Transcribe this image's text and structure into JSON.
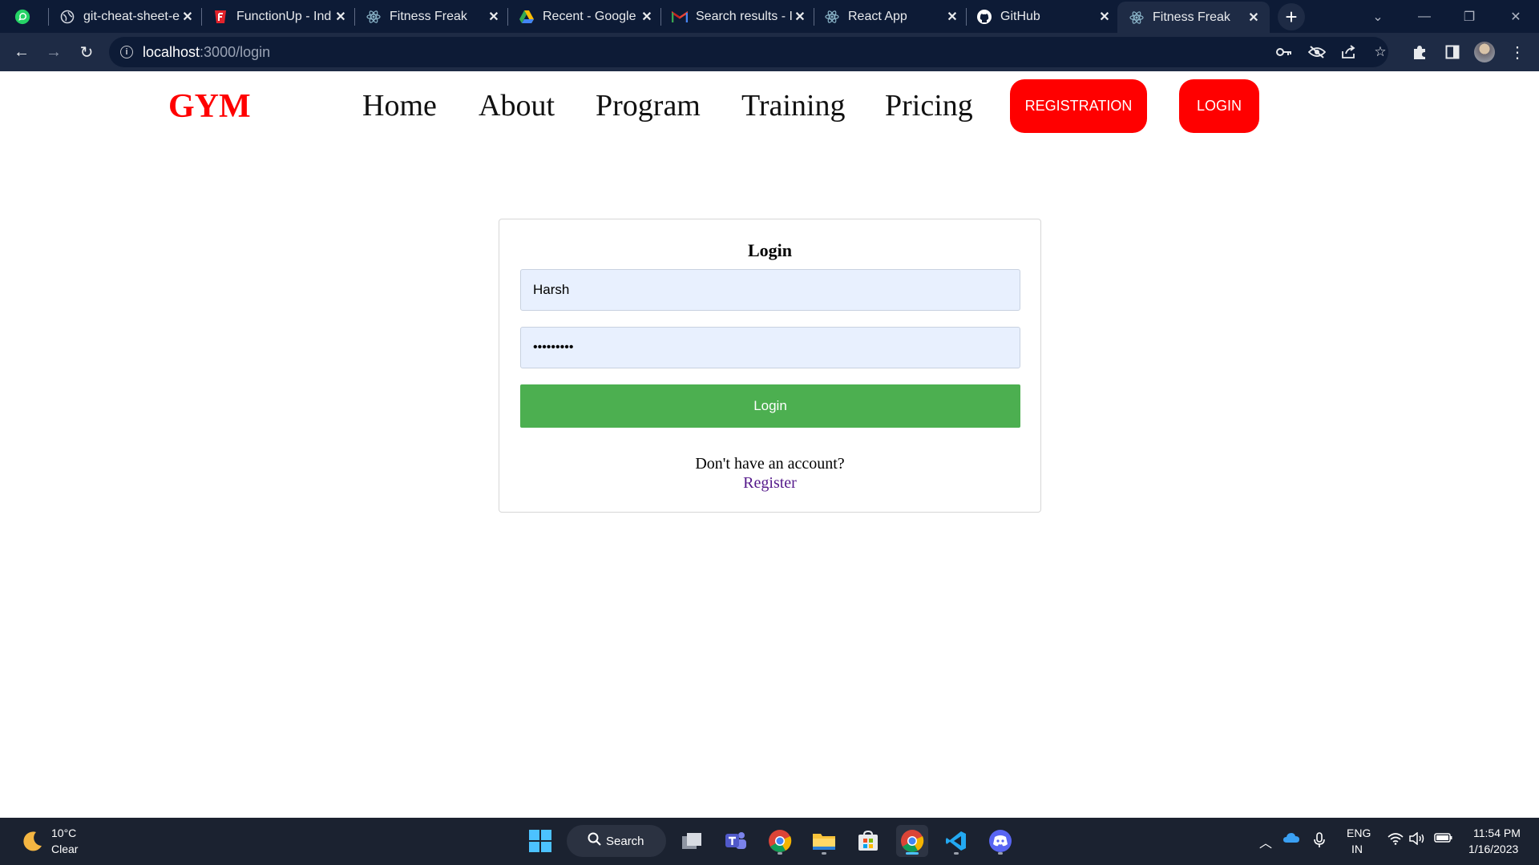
{
  "browser": {
    "tabs": [
      {
        "title": "",
        "icon": "whatsapp-icon"
      },
      {
        "title": "git-cheat-sheet-e",
        "icon": "globe-icon"
      },
      {
        "title": "FunctionUp - Ind",
        "icon": "functionup-icon"
      },
      {
        "title": "Fitness Freak",
        "icon": "react-icon"
      },
      {
        "title": "Recent - Google",
        "icon": "google-drive-icon"
      },
      {
        "title": "Search results - I",
        "icon": "gmail-icon"
      },
      {
        "title": "React App",
        "icon": "react-icon"
      },
      {
        "title": "GitHub",
        "icon": "github-icon"
      },
      {
        "title": "Fitness Freak",
        "icon": "react-icon"
      }
    ],
    "url_host": "localhost",
    "url_path": ":3000/login"
  },
  "site": {
    "logo": "GYM",
    "nav": {
      "home": "Home",
      "about": "About",
      "program": "Program",
      "training": "Training",
      "pricing": "Pricing",
      "registration": "REGISTRATION",
      "login": "LOGIN"
    },
    "accent_color": "#ff0000"
  },
  "login_form": {
    "title": "Login",
    "username_value": "Harsh",
    "password_value": "•••••••••",
    "submit_label": "Login",
    "prompt": "Don't have an account?",
    "register_link": "Register",
    "submit_color": "#4caf50"
  },
  "taskbar": {
    "temperature": "10°C",
    "condition": "Clear",
    "search_label": "Search",
    "lang_top": "ENG",
    "lang_bottom": "IN",
    "time": "11:54 PM",
    "date": "1/16/2023"
  }
}
